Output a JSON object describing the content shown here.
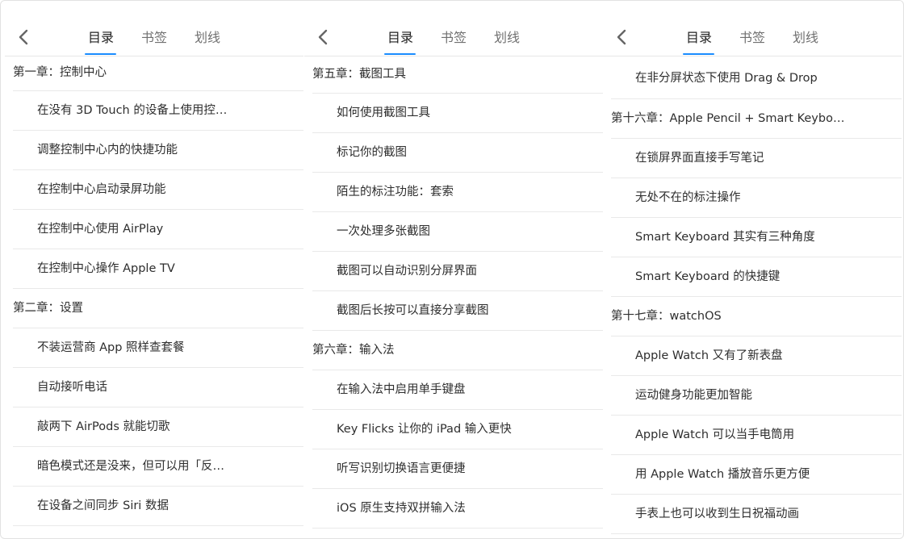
{
  "panels": [
    {
      "tabs": [
        "目录",
        "书签",
        "划线"
      ],
      "active_tab": "目录",
      "items": [
        {
          "type": "chapter",
          "text": "第一章：控制中心"
        },
        {
          "type": "section",
          "text": "在没有 3D Touch 的设备上使用控…"
        },
        {
          "type": "section",
          "text": "调整控制中心内的快捷功能"
        },
        {
          "type": "section",
          "text": "在控制中心启动录屏功能"
        },
        {
          "type": "section",
          "text": "在控制中心使用 AirPlay"
        },
        {
          "type": "section",
          "text": "在控制中心操作 Apple TV"
        },
        {
          "type": "chapter",
          "text": "第二章：设置"
        },
        {
          "type": "section",
          "text": "不装运营商 App 照样查套餐"
        },
        {
          "type": "section",
          "text": "自动接听电话"
        },
        {
          "type": "section",
          "text": "敲两下 AirPods 就能切歌"
        },
        {
          "type": "section",
          "text": "暗色模式还是没来，但可以用「反…"
        },
        {
          "type": "section",
          "text": "在设备之间同步 Siri 数据"
        }
      ]
    },
    {
      "tabs": [
        "目录",
        "书签",
        "划线"
      ],
      "active_tab": "目录",
      "items": [
        {
          "type": "chapter",
          "text": "第五章：截图工具"
        },
        {
          "type": "section",
          "text": "如何使用截图工具"
        },
        {
          "type": "section",
          "text": "标记你的截图"
        },
        {
          "type": "section",
          "text": "陌生的标注功能：套索"
        },
        {
          "type": "section",
          "text": "一次处理多张截图"
        },
        {
          "type": "section",
          "text": "截图可以自动识别分屏界面"
        },
        {
          "type": "section",
          "text": "截图后长按可以直接分享截图"
        },
        {
          "type": "chapter",
          "text": "第六章：输入法"
        },
        {
          "type": "section",
          "text": "在输入法中启用单手键盘"
        },
        {
          "type": "section",
          "text": "Key Flicks 让你的 iPad 输入更快"
        },
        {
          "type": "section",
          "text": "听写识别切换语言更便捷"
        },
        {
          "type": "section",
          "text": "iOS 原生支持双拼输入法"
        }
      ]
    },
    {
      "tabs": [
        "目录",
        "书签",
        "划线"
      ],
      "active_tab": "目录",
      "items": [
        {
          "type": "section",
          "text": "在非分屏状态下使用 Drag & Drop"
        },
        {
          "type": "chapter",
          "text": "第十六章：Apple Pencil + Smart Keybo…"
        },
        {
          "type": "section",
          "text": "在锁屏界面直接手写笔记"
        },
        {
          "type": "section",
          "text": "无处不在的标注操作"
        },
        {
          "type": "section",
          "text": "Smart Keyboard 其实有三种角度"
        },
        {
          "type": "section",
          "text": "Smart Keyboard 的快捷键"
        },
        {
          "type": "chapter",
          "text": "第十七章：watchOS"
        },
        {
          "type": "section",
          "text": "Apple Watch 又有了新表盘"
        },
        {
          "type": "section",
          "text": "运动健身功能更加智能"
        },
        {
          "type": "section",
          "text": "Apple Watch 可以当手电筒用"
        },
        {
          "type": "section",
          "text": "用 Apple Watch 播放音乐更方便"
        },
        {
          "type": "section",
          "text": "手表上也可以收到生日祝福动画"
        }
      ]
    }
  ],
  "icons": {
    "back": "chevron-left-icon"
  },
  "colors": {
    "accent": "#1a8cff",
    "text": "#2e2e2e",
    "tab_inactive": "#707070",
    "divider": "#e9e9e9"
  }
}
